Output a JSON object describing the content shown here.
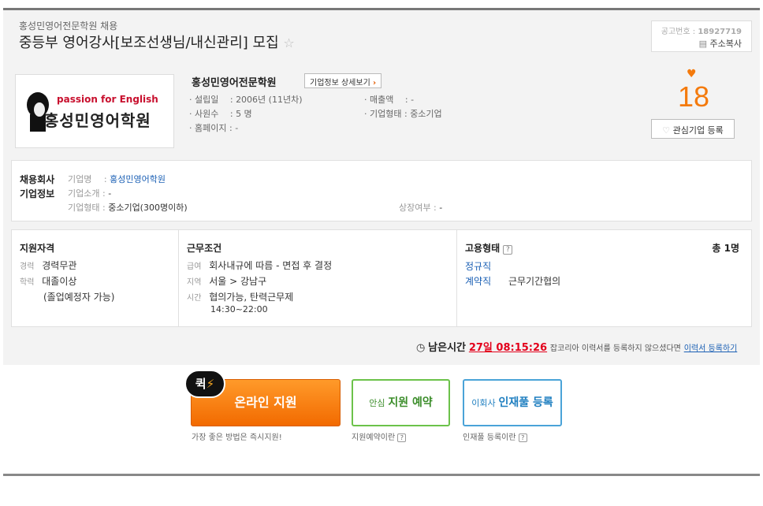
{
  "header": {
    "company_line": "홍성민영어전문학원 채용",
    "title": "중등부 영어강사[보조선생님/내신관리] 모집",
    "notice_label": "공고번호 :",
    "notice_number": "18927719",
    "copy_address": "주소복사"
  },
  "company_card": {
    "logo_text_en": "passion for English",
    "logo_text_kr": "홍성민영어학원",
    "name": "홍성민영어전문학원",
    "detail_button": "기업정보 상세보기",
    "founded_label": "· 설립일 　:",
    "founded_value": "2006년 (11년차)",
    "employees_label": "· 사원수 　:",
    "employees_value": "5 명",
    "homepage_label": "· 홈페이지 :",
    "homepage_value": "-",
    "revenue_label": "· 매출액 　:",
    "revenue_value": "-",
    "type_label": "· 기업형태 :",
    "type_value": "중소기업",
    "interest_count": "18",
    "interest_button": "관심기업 등록"
  },
  "company_info": {
    "title_line1": "채용회사",
    "title_line2": "기업정보",
    "name_label": "기업명",
    "name_value": "홍성민영어학원",
    "intro_label": "기업소개",
    "intro_value": "-",
    "type_label": "기업형태",
    "type_value": "중소기업(300명이하)",
    "listed_label": "상장여부",
    "listed_value": "-"
  },
  "qualification": {
    "title": "지원자격",
    "career_label": "경력",
    "career_value": "경력무관",
    "education_label": "학력",
    "education_value": "대졸이상",
    "education_note": "(졸업예정자 가능)"
  },
  "conditions": {
    "title": "근무조건",
    "salary_label": "급여",
    "salary_value": "회사내규에 따름 - 면접 후 결정",
    "region_label": "지역",
    "region_value": "서울 > 강남구",
    "time_label": "시간",
    "time_value": "협의가능, 탄력근무제",
    "time_value2": "14:30~22:00"
  },
  "employment": {
    "title": "고용형태",
    "total": "총 1명",
    "type1": "정규직",
    "type2": "계약직",
    "type2_desc": "근무기간협의"
  },
  "deadline": {
    "label": "남은시간",
    "value": "27일 08:15:26",
    "text": "잡코리아 이력서를 등록하지 않으셨다면",
    "link": "이력서 등록하기"
  },
  "actions": {
    "quick_badge": "퀵",
    "online_apply": "온라인 지원",
    "online_caption": "가장 좋은 방법은 즉시지원!",
    "reserve_prefix": "안심",
    "reserve_main": "지원 예약",
    "reserve_caption": "지원예약이란",
    "talent_prefix": "이회사",
    "talent_main": "인재풀 등록",
    "talent_caption": "인재풀 등록이란"
  },
  "colors": {
    "orange": "#f47a0c",
    "green": "#5cb85c",
    "blue": "#2b88c8",
    "red": "#e3001b"
  }
}
